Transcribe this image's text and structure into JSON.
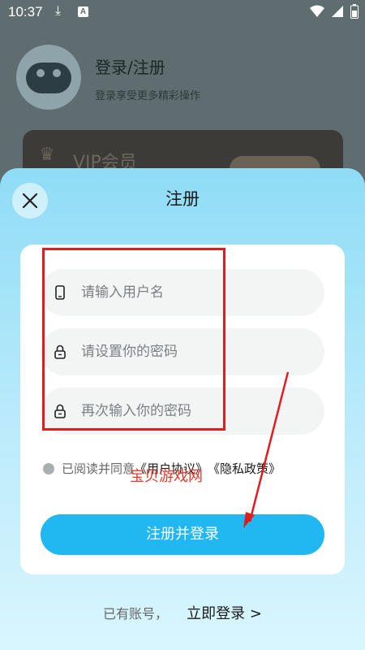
{
  "status_bar": {
    "time": "10:37"
  },
  "background": {
    "title": "登录/注册",
    "subtitle": "登录享受更多精彩操作",
    "vip_label": "VIP会员"
  },
  "sheet": {
    "title": "注册",
    "fields": {
      "username": {
        "placeholder": "请输入用户名",
        "value": ""
      },
      "password": {
        "placeholder": "请设置你的密码",
        "value": ""
      },
      "confirm": {
        "placeholder": "再次输入你的密码",
        "value": ""
      }
    },
    "agreement": {
      "prefix": "已阅读并同意",
      "user_agreement": "《用户协议》",
      "privacy_policy": "《隐私政策》"
    },
    "submit_label": "注册并登录",
    "have_account": "已有账号，",
    "login_link": "立即登录 >"
  },
  "watermark": "宝贝游戏网",
  "colors": {
    "accent": "#21b8f1",
    "annotation": "#e11c1c"
  }
}
